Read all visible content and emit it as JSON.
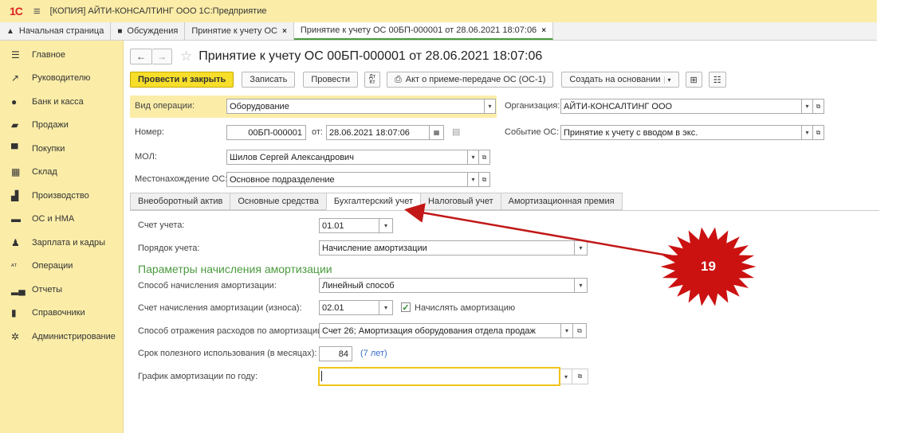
{
  "app": {
    "logo": "1С",
    "title": "[КОПИЯ] АЙТИ-КОНСАЛТИНГ ООО 1С:Предприятие"
  },
  "tabs": [
    {
      "label": "Начальная страница",
      "icon": "home-icon"
    },
    {
      "label": "Обсуждения",
      "icon": "chat-icon"
    },
    {
      "label": "Принятие к учету ОС",
      "icon": ""
    },
    {
      "label": "Принятие к учету ОС 00БП-000001 от 28.06.2021 18:07:06",
      "icon": ""
    }
  ],
  "sidebar": {
    "items": [
      {
        "label": "Главное",
        "icon": "menu-icon"
      },
      {
        "label": "Руководителю",
        "icon": "trend-icon"
      },
      {
        "label": "Банк и касса",
        "icon": "ruble-icon"
      },
      {
        "label": "Продажи",
        "icon": "bag-icon"
      },
      {
        "label": "Покупки",
        "icon": "cart-icon"
      },
      {
        "label": "Склад",
        "icon": "warehouse-icon"
      },
      {
        "label": "Производство",
        "icon": "factory-icon"
      },
      {
        "label": "ОС и НМА",
        "icon": "truck-icon"
      },
      {
        "label": "Зарплата и кадры",
        "icon": "person-icon"
      },
      {
        "label": "Операции",
        "icon": "dt-kt-icon"
      },
      {
        "label": "Отчеты",
        "icon": "bar-chart-icon"
      },
      {
        "label": "Справочники",
        "icon": "book-icon"
      },
      {
        "label": "Администрирование",
        "icon": "gear-icon"
      }
    ]
  },
  "doc": {
    "title": "Принятие к учету ОС 00БП-000001 от 28.06.2021 18:07:06"
  },
  "toolbar": {
    "post_close": "Провести и закрыть",
    "save": "Записать",
    "post": "Провести",
    "dtkt_top": "Дт",
    "dtkt_bottom": "Кт",
    "act": "Акт о приеме-передаче ОС (ОС-1)",
    "create_basis": "Создать на основании"
  },
  "form": {
    "op_type_label": "Вид операции:",
    "op_type_value": "Оборудование",
    "org_label": "Организация:",
    "org_value": "АЙТИ-КОНСАЛТИНГ ООО",
    "number_label": "Номер:",
    "number_value": "00БП-000001",
    "date_from_label": "от:",
    "date_value": "28.06.2021 18:07:06",
    "event_label": "Событие ОС:",
    "event_value": "Принятие к учету с вводом в экс.",
    "mol_label": "МОЛ:",
    "mol_value": "Шилов Сергей Александрович",
    "location_label": "Местонахождение ОС:",
    "location_value": "Основное подразделение"
  },
  "inner_tabs": [
    "Внеоборотный актив",
    "Основные средства",
    "Бухгалтерский учет",
    "Налоговый учет",
    "Амортизационная премия"
  ],
  "accounting": {
    "account_label": "Счет учета:",
    "account_value": "01.01",
    "order_label": "Порядок учета:",
    "order_value": "Начисление амортизации",
    "section_title": "Параметры начисления амортизации",
    "method_label": "Способ начисления амортизации:",
    "method_value": "Линейный способ",
    "dep_account_label": "Счет начисления амортизации (износа):",
    "dep_account_value": "02.01",
    "accrue_label": "Начислять амортизацию",
    "accrue_checked": true,
    "expense_label": "Способ отражения расходов по амортизации:",
    "expense_value": "Счет 26; Амортизация оборудования отдела продаж",
    "life_label": "Срок полезного использования (в месяцах):",
    "life_value": "84",
    "life_years": "(7 лет)",
    "schedule_label": "График амортизации по году:",
    "schedule_value": ""
  },
  "annotation": {
    "number": "19",
    "color": "#cc1111"
  }
}
